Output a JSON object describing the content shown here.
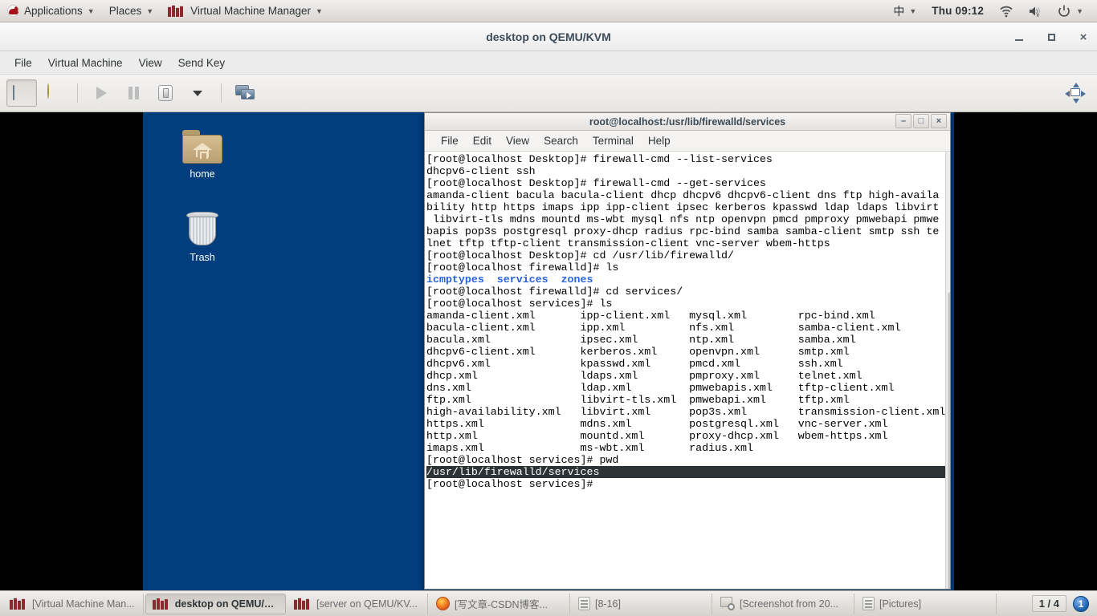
{
  "gnome_panel": {
    "left_items": [
      {
        "icon": "redhat-logo-icon",
        "label": "Applications",
        "caret": "▼"
      },
      {
        "icon": null,
        "label": "Places",
        "caret": "▼"
      },
      {
        "icon": "vmm-logo-icon",
        "label": "Virtual Machine Manager",
        "caret": "▼"
      }
    ],
    "ime_indicator": "中",
    "ime_caret": "▼",
    "clock": "Thu 09:12",
    "tray_icons": [
      "wifi-icon",
      "volume-muted-icon",
      "power-icon",
      "chevron-down-icon"
    ]
  },
  "vmm_window": {
    "title": "desktop on QEMU/KVM",
    "window_buttons": {
      "minimize": "–",
      "maximize": "□",
      "close": "×"
    },
    "menus": [
      "File",
      "Virtual Machine",
      "View",
      "Send Key"
    ],
    "toolbar": [
      {
        "name": "show-console-button",
        "icon": "monitor-icon",
        "state": "pressed"
      },
      {
        "name": "show-details-button",
        "icon": "lightbulb-icon",
        "state": "normal"
      },
      {
        "name": "run-button",
        "icon": "play-icon",
        "state": "disabled"
      },
      {
        "name": "pause-button",
        "icon": "pause-icon",
        "state": "disabled"
      },
      {
        "name": "shutdown-button",
        "icon": "shutdown-icon",
        "state": "normal"
      },
      {
        "name": "shutdown-menu-button",
        "icon": "chevron-down-icon",
        "state": "normal"
      },
      {
        "name": "fullscreen-button",
        "icon": "dual-monitor-icon",
        "state": "normal"
      },
      {
        "name": "resize-to-vm-button",
        "icon": "resize-arrows-icon",
        "state": "normal"
      }
    ]
  },
  "vm_desktop": {
    "background_color": "#023d7e",
    "icons": [
      {
        "name": "desktop-icon-home",
        "icon": "home-folder-icon",
        "label": "home"
      },
      {
        "name": "desktop-icon-trash",
        "icon": "trash-icon",
        "label": "Trash"
      }
    ]
  },
  "terminal": {
    "title": "root@localhost:/usr/lib/firewalld/services",
    "window_buttons": {
      "minimize": "–",
      "maximize": "□",
      "close": "×"
    },
    "menus": [
      "File",
      "Edit",
      "View",
      "Search",
      "Terminal",
      "Help"
    ],
    "lines": [
      {
        "type": "plain",
        "text": "[root@localhost Desktop]# firewall-cmd --list-services"
      },
      {
        "type": "plain",
        "text": "dhcpv6-client ssh"
      },
      {
        "type": "plain",
        "text": "[root@localhost Desktop]# firewall-cmd --get-services"
      },
      {
        "type": "plain",
        "text": "amanda-client bacula bacula-client dhcp dhcpv6 dhcpv6-client dns ftp high-availa"
      },
      {
        "type": "plain",
        "text": "bility http https imaps ipp ipp-client ipsec kerberos kpasswd ldap ldaps libvirt"
      },
      {
        "type": "plain",
        "text": " libvirt-tls mdns mountd ms-wbt mysql nfs ntp openvpn pmcd pmproxy pmwebapi pmwe"
      },
      {
        "type": "plain",
        "text": "bapis pop3s postgresql proxy-dhcp radius rpc-bind samba samba-client smtp ssh te"
      },
      {
        "type": "plain",
        "text": "lnet tftp tftp-client transmission-client vnc-server wbem-https"
      },
      {
        "type": "plain",
        "text": "[root@localhost Desktop]# cd /usr/lib/firewalld/"
      },
      {
        "type": "plain",
        "text": "[root@localhost firewalld]# ls"
      },
      {
        "type": "dir",
        "text": "icmptypes  services  zones"
      },
      {
        "type": "plain",
        "text": "[root@localhost firewalld]# cd services/"
      },
      {
        "type": "plain",
        "text": "[root@localhost services]# ls"
      },
      {
        "type": "plain",
        "text": "amanda-client.xml       ipp-client.xml   mysql.xml        rpc-bind.xml"
      },
      {
        "type": "plain",
        "text": "bacula-client.xml       ipp.xml          nfs.xml          samba-client.xml"
      },
      {
        "type": "plain",
        "text": "bacula.xml              ipsec.xml        ntp.xml          samba.xml"
      },
      {
        "type": "plain",
        "text": "dhcpv6-client.xml       kerberos.xml     openvpn.xml      smtp.xml"
      },
      {
        "type": "plain",
        "text": "dhcpv6.xml              kpasswd.xml      pmcd.xml         ssh.xml"
      },
      {
        "type": "plain",
        "text": "dhcp.xml                ldaps.xml        pmproxy.xml      telnet.xml"
      },
      {
        "type": "plain",
        "text": "dns.xml                 ldap.xml         pmwebapis.xml    tftp-client.xml"
      },
      {
        "type": "plain",
        "text": "ftp.xml                 libvirt-tls.xml  pmwebapi.xml     tftp.xml"
      },
      {
        "type": "plain",
        "text": "high-availability.xml   libvirt.xml      pop3s.xml        transmission-client.xml"
      },
      {
        "type": "plain",
        "text": "https.xml               mdns.xml         postgresql.xml   vnc-server.xml"
      },
      {
        "type": "plain",
        "text": "http.xml                mountd.xml       proxy-dhcp.xml   wbem-https.xml"
      },
      {
        "type": "plain",
        "text": "imaps.xml               ms-wbt.xml       radius.xml"
      },
      {
        "type": "plain",
        "text": "[root@localhost services]# pwd"
      },
      {
        "type": "highlight",
        "text": "/usr/lib/firewalld/services"
      },
      {
        "type": "plain",
        "text": "[root@localhost services]#"
      }
    ]
  },
  "taskbar": {
    "buttons": [
      {
        "name": "task-virtual-machine-manager",
        "icon": "vmm-logo-icon",
        "label": "[Virtual Machine Man...",
        "active": false
      },
      {
        "name": "task-desktop-vm",
        "icon": "vmm-logo-icon",
        "label": "desktop on QEMU/K...",
        "active": true
      },
      {
        "name": "task-server-vm",
        "icon": "vmm-logo-icon",
        "label": "[server on QEMU/KV...",
        "active": false
      },
      {
        "name": "task-firefox",
        "icon": "firefox-icon",
        "label": "[写文章-CSDN博客...",
        "active": false
      },
      {
        "name": "task-file-8-16",
        "icon": "archive-icon",
        "label": "[8-16]",
        "active": false
      },
      {
        "name": "task-screenshot",
        "icon": "screenshot-icon",
        "label": "[Screenshot from 20...",
        "active": false
      },
      {
        "name": "task-pictures",
        "icon": "archive-icon",
        "label": "[Pictures]",
        "active": false
      }
    ],
    "workspace_indicator": "1 / 4",
    "notification_count": "1"
  }
}
